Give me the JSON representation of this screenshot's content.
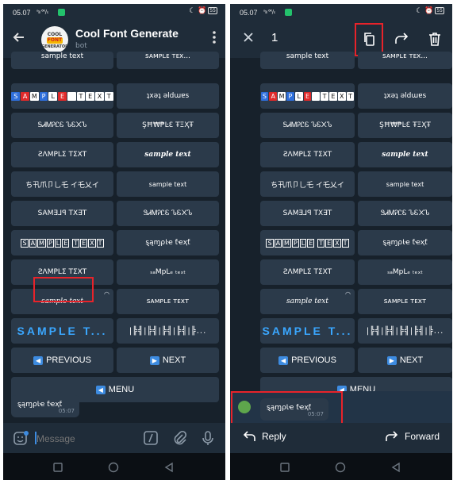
{
  "status": {
    "time": "05.07",
    "signal": "ᵃᵢₗₗ ⁶ᴷ/ₛ",
    "right_icons": "☾ ⏰",
    "battery": "55"
  },
  "left": {
    "header": {
      "title": "Cool Font Generate",
      "subtitle": "bot",
      "avatar": {
        "line1": "COOL",
        "line2": "FONT",
        "line3": "GENERATOR"
      }
    },
    "keyboard": [
      [
        "sample text",
        "ꜱᴀᴍᴘʟᴇ ᴛᴇx..."
      ],
      [
        "SAMPLE TEXT",
        "ʇxǝʇ ǝldɯɐs"
      ],
      [
        "ᎦᏗᎷᎮᏝᏋ ᏖᏋ᙭Ꮦ",
        "ŞĦ₩₱ĿƐ ŦΞҲŦ"
      ],
      [
        "ƧΛMPLΣ TΣXT",
        "sample text"
      ],
      [
        "ち卂爪卩乚乇 イ乇乂イ",
        "sample text"
      ],
      [
        "SAMƎ⅃ꟼ TX∃T",
        "ᏕᏗᎷᎮᏝᏋ ᏖᏋ᙭Ꮦ"
      ],
      [
        "SAMPLE TEXT",
        "ȿąɱρƖҽ ƭҽҳƭ"
      ],
      [
        "ƧΛMPᒪΣ TΣXT",
        "ₛₐMpᒪₑ ₜₑₓₜ"
      ],
      [
        "sample text",
        "ꜱᴀᴍᴘʟᴇ ᴛᴇxᴛ"
      ],
      [
        "SAMPLE T...",
        "|╠╣|╠╣|╠╣|╠╣|╠..."
      ],
      [
        "PREVIOUS",
        "NEXT"
      ],
      [
        "MENU"
      ]
    ],
    "message": {
      "text": "ȿąɱρƖҽ ƭҽҳƭ",
      "time": "05:07"
    },
    "input": {
      "placeholder": "Message"
    }
  },
  "right": {
    "toolbar": {
      "count": "1"
    },
    "keyboard": [
      [
        "sample text",
        "ꜱᴀᴍᴘʟᴇ ᴛᴇx..."
      ],
      [
        "SAMPLE TEXT",
        "ʇxǝʇ ǝldɯɐs"
      ],
      [
        "ᎦᏗᎷᎮᏝᏋ ᏖᏋ᙭Ꮦ",
        "ŞĦ₩₱ĿƐ ŦΞҲŦ"
      ],
      [
        "ƧΛMPLΣ TΣXT",
        "sample text"
      ],
      [
        "ち卂爪卩乚乇 イ乇乂イ",
        "sample text"
      ],
      [
        "SAMƎ⅃ꟼ TX∃T",
        "ᏕᏗᎷᎮᏝᏋ ᏖᏋ᙭Ꮦ"
      ],
      [
        "SAMPLE TEXT",
        "ȿąɱρƖҽ ƭҽҳƭ"
      ],
      [
        "ƧΛMPᒪΣ TΣXT",
        "ₛₐMpᒪₑ ₜₑₓₜ"
      ],
      [
        "sample text",
        "ꜱᴀᴍᴘʟᴇ ᴛᴇxᴛ"
      ],
      [
        "SAMPLE T...",
        "|╠╣|╠╣|╠╣|╠╣|╠..."
      ],
      [
        "PREVIOUS",
        "NEXT"
      ],
      [
        "MENU"
      ]
    ],
    "message": {
      "text": "ȿąɱρƖҽ ƭҽҳƭ",
      "time": "05:07"
    },
    "actions": {
      "reply": "Reply",
      "forward": "Forward"
    }
  },
  "icons": {
    "back": "back-arrow-icon",
    "more": "more-vertical-icon",
    "close": "close-icon",
    "copy": "copy-icon",
    "forward": "forward-icon",
    "delete": "trash-icon",
    "emoji": "emoji-icon",
    "commands": "commands-icon",
    "attach": "paperclip-icon",
    "mic": "microphone-icon",
    "reply": "reply-icon",
    "home": "home-icon",
    "recents": "recents-icon",
    "nav_back": "nav-back-icon"
  },
  "colors": {
    "background": "#17212b",
    "header": "#1f2c39",
    "key": "#2b3a4a",
    "accent": "#3d8be0",
    "highlight": "#e8232a",
    "check": "#5ea64c"
  }
}
